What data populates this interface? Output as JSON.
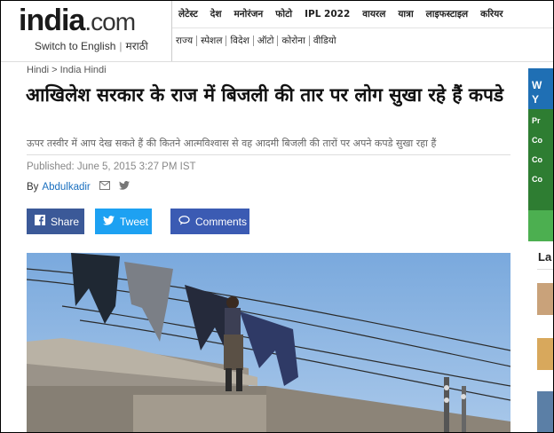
{
  "header": {
    "logo_main": "india",
    "logo_suffix": ".com",
    "switch_english": "Switch to English",
    "marathi": "मराठी",
    "nav_primary": [
      "लेटेस्ट",
      "देश",
      "मनोरंजन",
      "फोटो",
      "IPL 2022",
      "वायरल",
      "यात्रा",
      "लाइफस्टाइल",
      "करियर"
    ],
    "nav_secondary": [
      "राज्य",
      "स्पेशल",
      "विदेश",
      "ऑटो",
      "कोरोना",
      "वीडियो"
    ]
  },
  "breadcrumb": "Hindi > India Hindi",
  "article": {
    "title": "आखिलेश सरकार के राज में बिजली की तार पर लोग सुखा रहे हैं कपडे",
    "summary": "ऊपर तस्वीर में आप देख सकते हैं की कितने आत्मविश्वास से वह आदमी बिजली की तारों पर अपने कपडे सुखा रहा हैं",
    "published": "Published: June 5, 2015 3:27 PM IST",
    "by_label": "By",
    "author": "Abdulkadir"
  },
  "share": {
    "facebook": "Share",
    "twitter": "Tweet",
    "comments": "Comments"
  },
  "sidebar": {
    "ad_letters": [
      "W",
      "Y"
    ],
    "ad_rows": [
      "Pr",
      "Co",
      "Co",
      "Co"
    ],
    "latest_label": "La"
  },
  "colors": {
    "facebook": "#3b5998",
    "twitter": "#1da1f2",
    "comments": "#3b5bb3",
    "logo_dot": "#e53935",
    "author_link": "#1a6fbf"
  }
}
